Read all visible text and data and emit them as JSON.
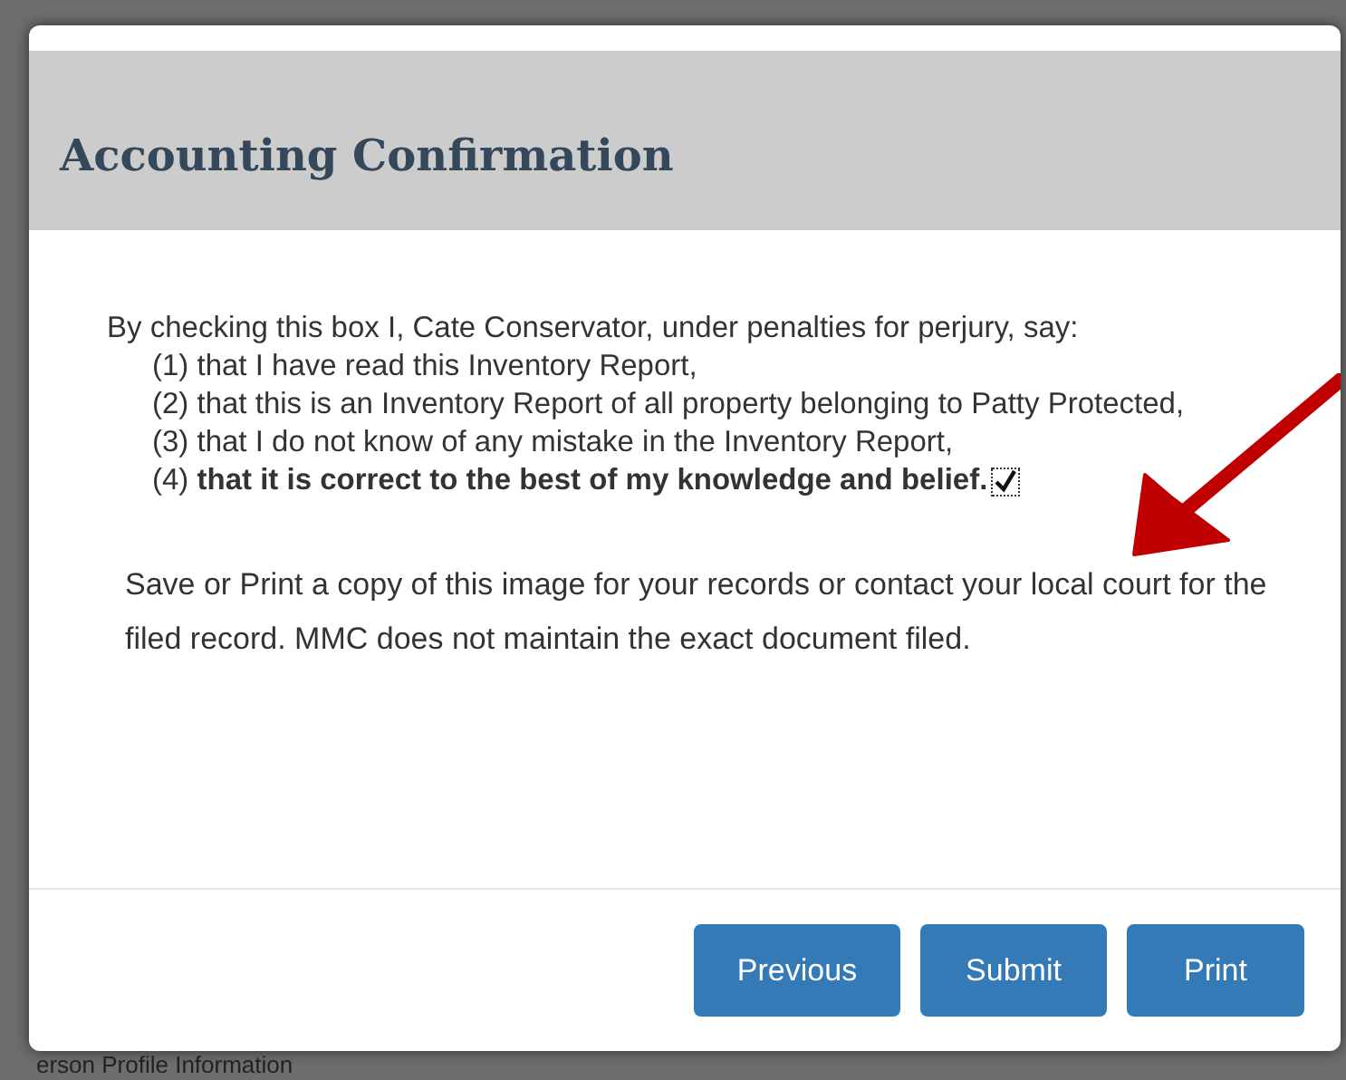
{
  "dialog": {
    "title": "Accounting Confirmation",
    "declaration": {
      "intro": "By checking this box I, Cate Conservator, under penalties for perjury, say:",
      "items": [
        "(1) that I have read this Inventory Report,",
        "(2) that this is an Inventory Report of all property belonging to Patty Protected,",
        "(3) that I do not know of any mistake in the Inventory Report,",
        "(4) **that it is correct to the best of my knowledge and belief.**"
      ],
      "checked": true
    },
    "note": "Save or Print a copy of this image for your records or contact your local court for the filed record. MMC does not maintain the exact document filed.",
    "buttons": [
      "Previous",
      "Submit",
      "Print"
    ]
  },
  "background_text": "erson Profile Information"
}
